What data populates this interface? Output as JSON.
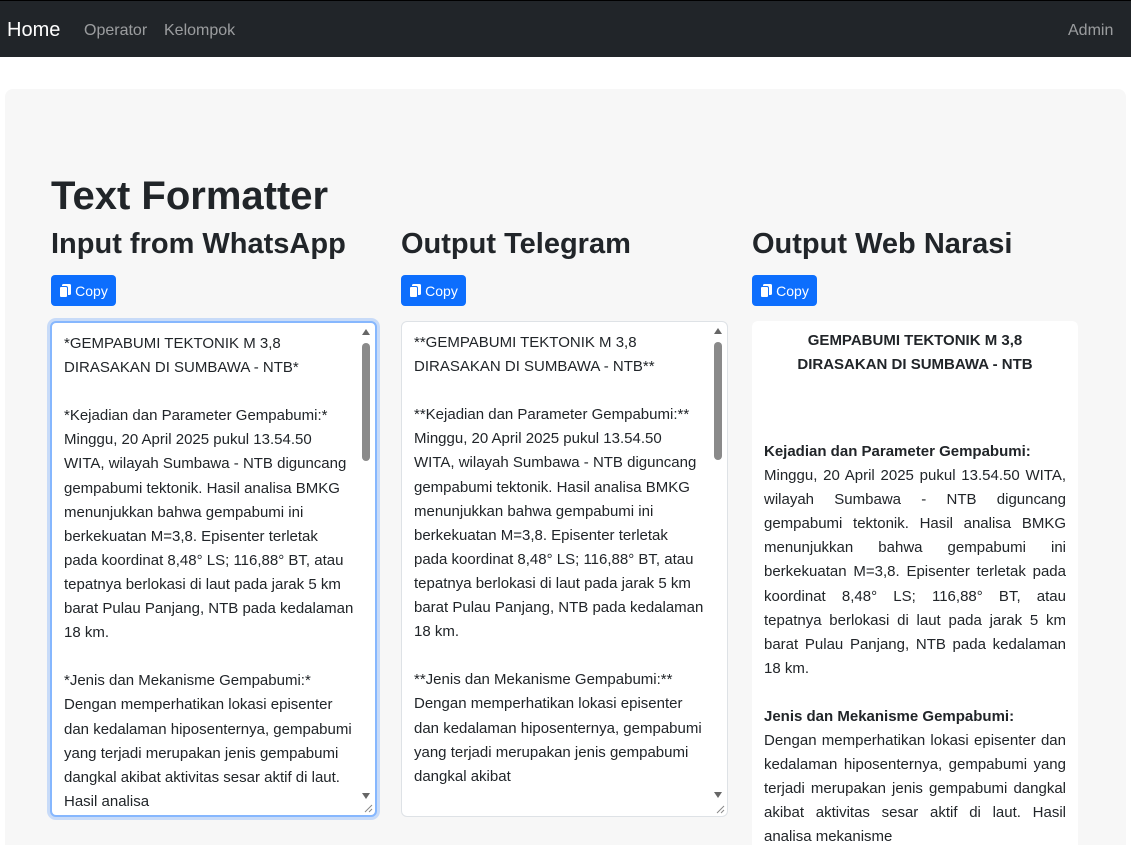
{
  "nav": {
    "brand": "Home",
    "items": [
      "Operator",
      "Kelompok"
    ],
    "user": "Admin"
  },
  "page": {
    "title": "Text Formatter"
  },
  "columns": {
    "input": {
      "title": "Input from WhatsApp",
      "copy_label": "Copy"
    },
    "telegram": {
      "title": "Output Telegram",
      "copy_label": "Copy"
    },
    "narasi": {
      "title": "Output Web Narasi",
      "copy_label": "Copy"
    }
  },
  "input_text": "*GEMPABUMI TEKTONIK M 3,8 DIRASAKAN DI SUMBAWA - NTB*\n\n*Kejadian dan Parameter Gempabumi:* Minggu, 20 April 2025 pukul 13.54.50 WITA, wilayah Sumbawa - NTB diguncang gempabumi tektonik. Hasil analisa BMKG menunjukkan bahwa gempabumi ini berkekuatan M=3,8. Episenter terletak pada koordinat 8,48° LS; 116,88° BT, atau tepatnya berlokasi di laut pada jarak 5 km barat Pulau Panjang, NTB pada kedalaman 18 km.\n\n*Jenis dan Mekanisme Gempabumi:* Dengan memperhatikan lokasi episenter dan kedalaman hiposenternya, gempabumi yang terjadi merupakan jenis gempabumi dangkal akibat aktivitas sesar aktif di laut. Hasil analisa",
  "telegram_text": "**GEMPABUMI TEKTONIK M 3,8 DIRASAKAN DI SUMBAWA - NTB**\n\n**Kejadian dan Parameter Gempabumi:**\nMinggu, 20 April 2025 pukul 13.54.50 WITA, wilayah Sumbawa - NTB diguncang gempabumi tektonik. Hasil analisa BMKG menunjukkan bahwa gempabumi ini berkekuatan M=3,8. Episenter terletak pada koordinat 8,48° LS; 116,88° BT, atau tepatnya berlokasi di laut pada jarak 5 km barat Pulau Panjang, NTB pada kedalaman 18 km.\n\n**Jenis dan Mekanisme Gempabumi:**\nDengan memperhatikan lokasi episenter dan kedalaman hiposenternya, gempabumi yang terjadi merupakan jenis gempabumi dangkal akibat",
  "narasi": {
    "title": "GEMPABUMI TEKTONIK M 3,8 DIRASAKAN DI SUMBAWA - NTB",
    "section1_head": "Kejadian dan Parameter Gempabumi:",
    "section1_body": "Minggu, 20 April 2025 pukul 13.54.50 WITA, wilayah Sumbawa - NTB diguncang gempabumi tektonik. Hasil analisa BMKG menunjukkan bahwa gempabumi ini berkekuatan M=3,8. Episenter terletak pada koordinat 8,48° LS; 116,88° BT, atau tepatnya berlokasi di laut pada jarak 5 km barat Pulau Panjang, NTB pada kedalaman 18 km.",
    "section2_head": "Jenis dan Mekanisme Gempabumi:",
    "section2_body": "Dengan memperhatikan lokasi episenter dan kedalaman hiposenternya, gempabumi yang terjadi merupakan jenis gempabumi dangkal akibat aktivitas sesar aktif di laut. Hasil analisa mekanisme"
  },
  "colors": {
    "navbar": "#212529",
    "primary": "#0d6efd",
    "panel": "#f7f7f7",
    "focus": "#86b7fe"
  },
  "icons": {
    "copy": "clipboard-copy-icon"
  }
}
